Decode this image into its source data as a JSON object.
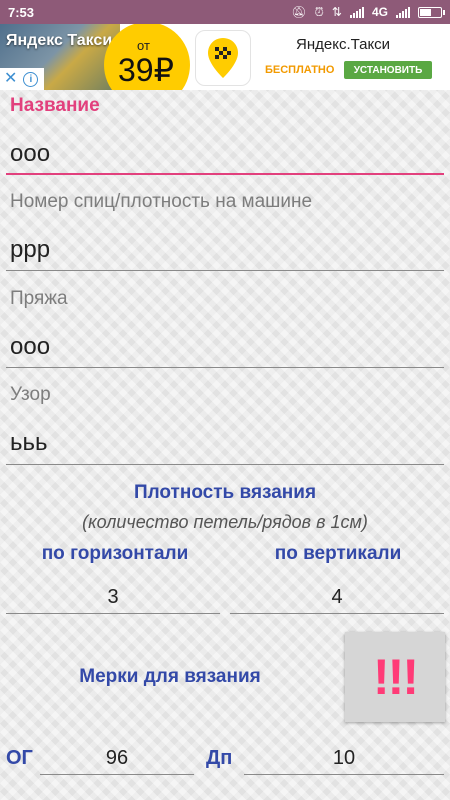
{
  "status_bar": {
    "time": "7:53",
    "network": "4G",
    "battery_level": 0.6,
    "icons": [
      "mute-icon",
      "alarm-icon",
      "data-icon",
      "signal-icon",
      "battery-icon"
    ]
  },
  "ad": {
    "brand": "Яндекс Такси",
    "from_label": "от",
    "price": "39₽",
    "title": "Яндекс.Такси",
    "free_label": "БЕСПЛАТНО",
    "install_label": "УСТАНОВИТЬ",
    "colors": {
      "yellow": "#ffcc00",
      "green": "#5aa843",
      "orange": "#f29a00"
    }
  },
  "form": {
    "name": {
      "label": "Название",
      "value": "ооо"
    },
    "needles": {
      "label": "Номер спиц/плотность на машине",
      "value": "ррр"
    },
    "yarn": {
      "label": "Пряжа",
      "value": "ооо"
    },
    "pattern": {
      "label": "Узор",
      "value": "ььь"
    }
  },
  "density": {
    "title": "Плотность вязания",
    "subtitle": "(количество петель/рядов в 1см)",
    "horizontal_label": "по горизонтали",
    "vertical_label": "по вертикали",
    "horizontal_value": "3",
    "vertical_value": "4"
  },
  "measurements": {
    "title": "Мерки для вязания",
    "button_label": "!!!",
    "og_label": "ОГ",
    "og_value": "96",
    "dp_label": "Дп",
    "dp_value": "10"
  },
  "colors": {
    "accent_pink": "#e2407d",
    "heading_blue": "#3349a8",
    "status_bar": "#8e5a78"
  }
}
